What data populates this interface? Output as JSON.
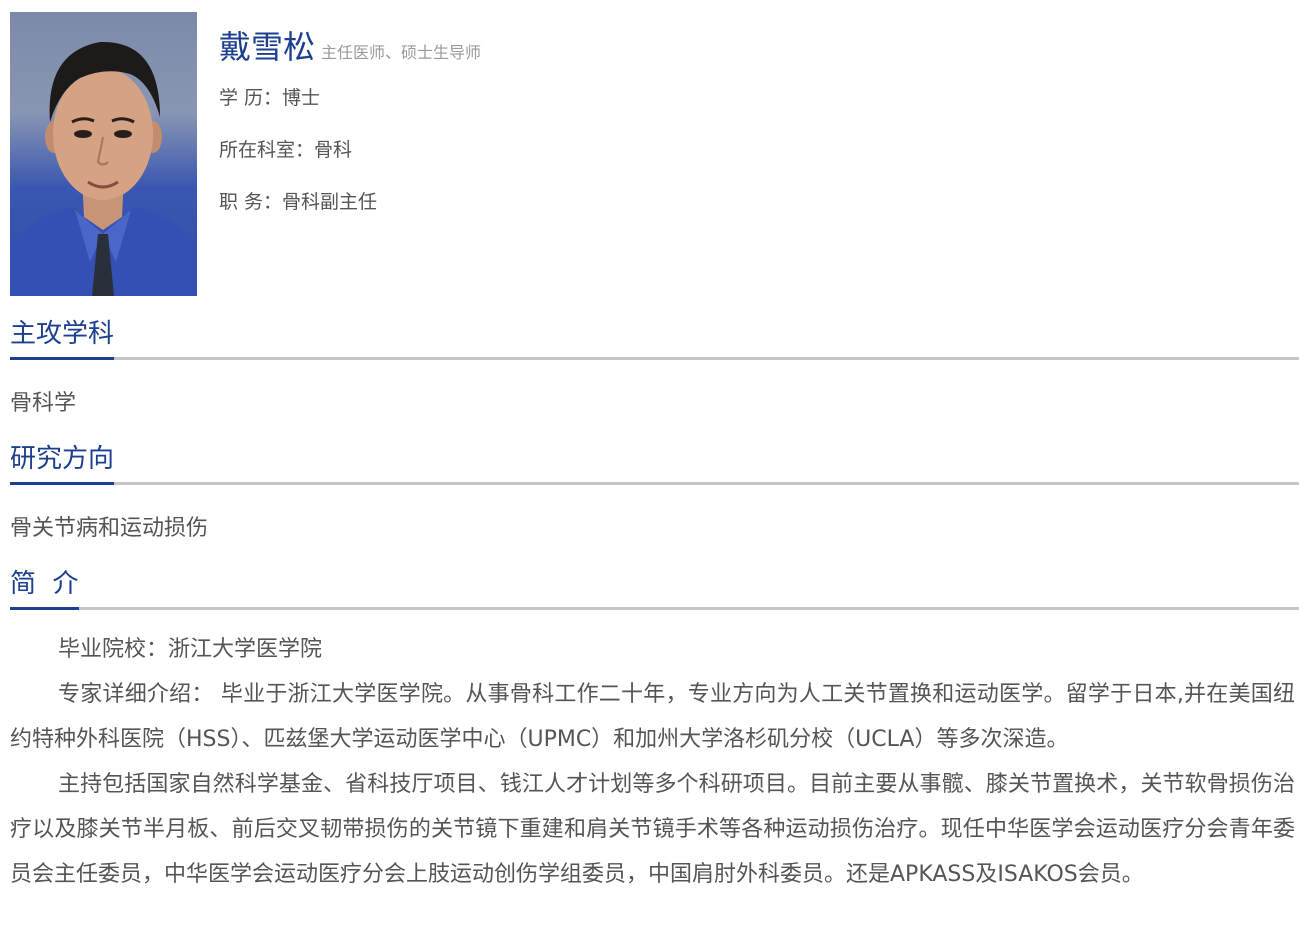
{
  "doctor": {
    "name": "戴雪松",
    "title": "主任医师、硕士生导师",
    "education": "学 历：博士",
    "department": "所在科室：骨科",
    "position": "职 务：骨科副主任"
  },
  "sections": {
    "specialty": {
      "heading": "主攻学科",
      "content": "骨科学"
    },
    "research": {
      "heading": "研究方向",
      "content": "骨关节病和运动损伤"
    },
    "intro": {
      "heading": "简  介",
      "paragraphs": [
        "毕业院校：浙江大学医学院",
        "专家详细介绍： 毕业于浙江大学医学院。从事骨科工作二十年，专业方向为人工关节置换和运动医学。留学于日本,并在美国纽约特种外科医院（HSS）、匹兹堡大学运动医学中心（UPMC）和加州大学洛杉矶分校（UCLA）等多次深造。",
        "主持包括国家自然科学基金、省科技厅项目、钱江人才计划等多个科研项目。目前主要从事髋、膝关节置换术，关节软骨损伤治疗以及膝关节半月板、前后交叉韧带损伤的关节镜下重建和肩关节镜手术等各种运动损伤治疗。现任中华医学会运动医疗分会青年委员会主任委员，中华医学会运动医疗分会上肢运动创伤学组委员，中国肩肘外科委员。还是APKASS及ISAKOS会员。"
      ]
    }
  },
  "colors": {
    "accent": "#1c3f8f",
    "divider": "#c4c6cc",
    "text": "#555555",
    "muted": "#9a9a9a"
  }
}
